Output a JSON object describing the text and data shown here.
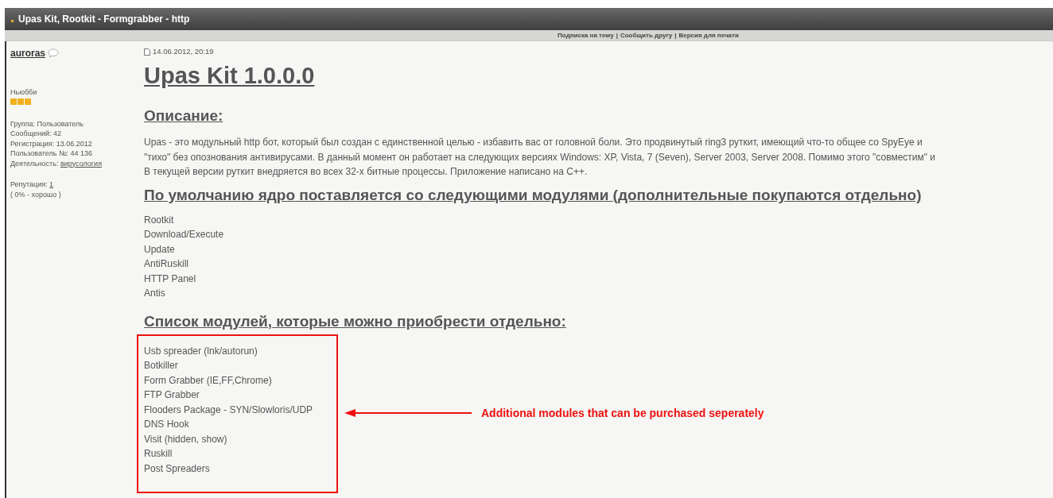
{
  "topic_bar": {
    "title": "Upas Kit, Rootkit - Formgrabber - http"
  },
  "topic_links": {
    "separator": "|",
    "items": [
      "Подписка на тему",
      "Сообщить другу",
      "Версия для печати"
    ]
  },
  "author": {
    "name": "auroras",
    "rank": "Ньюбби",
    "details": [
      {
        "label": "Группа:",
        "value": "Пользователь",
        "kind": "text"
      },
      {
        "label": "Сообщений:",
        "value": "42",
        "kind": "text"
      },
      {
        "label": "Регистрация:",
        "value": "13.06.2012",
        "kind": "text"
      },
      {
        "label": "Пользователь №:",
        "value": "44 136",
        "kind": "text"
      },
      {
        "label": "Деятельность:",
        "value": "вирусология",
        "kind": "link"
      }
    ],
    "reputation": {
      "label": "Репутация:",
      "value": "1",
      "note": "( 0% - хорошо )"
    }
  },
  "post": {
    "date": "14.06.2012, 20:19",
    "title": "Upas Kit 1.0.0.0",
    "description_heading": "Описание:",
    "description_lines": [
      "Upas - это модульный http бот, который был создан с единственной целью - избавить вас от головной боли. Это продвинутый ring3 руткит, имеющий что-то общее со SpyEye и",
      "\"тихо\" без опознования антивирусами. В данный момент он работает на следующих версиях Windows: XP, Vista, 7 (Seven), Server 2003, Server 2008. Помимо этого \"совместим\" и",
      "В текущей версии руткит внедряется во всех 32-х битные процессы. Приложение написано на C++."
    ],
    "default_modules_heading": "По умолчанию ядро поставляется со следующими модулями (дополнительные покупаются отдельно)",
    "default_modules": [
      "Rootkit",
      "Download/Execute",
      "Update",
      "AntiRuskill",
      "HTTP Panel",
      "Antis"
    ],
    "extra_modules_heading": "Список модулей, которые можно приобрести отдельно:",
    "extra_modules": [
      "Usb spreader (lnk/autorun)",
      "Botkiller",
      "Form Grabber (IE,FF,Chrome)",
      "FTP Grabber",
      "Flooders Package - SYN/Slowloris/UDP",
      "DNS Hook",
      "Visit (hidden, show)",
      "Ruskill",
      "Post Spreaders"
    ]
  },
  "annotation": {
    "text": "Additional modules that can be purchased seperately"
  }
}
